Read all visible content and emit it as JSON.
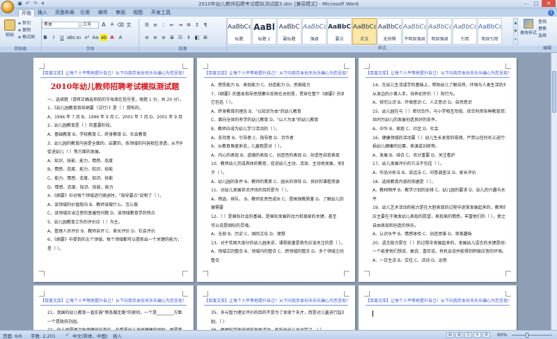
{
  "window": {
    "title": "2010年幼儿教师招聘考试模拟测试题3.doc [兼容模式] - Microsoft Word"
  },
  "tabs": [
    "开始",
    "插入",
    "页面布局",
    "引用",
    "邮件",
    "审阅",
    "视图",
    "开发工具"
  ],
  "clipboard": {
    "paste": "粘贴",
    "cut": "剪切",
    "copy": "复制",
    "format_painter": "格式刷",
    "label": "剪贴板"
  },
  "font": {
    "name": "黑体",
    "size": "三号",
    "grow": "A",
    "shrink": "A",
    "label": "字体"
  },
  "paragraph": {
    "label": "段落"
  },
  "styles": {
    "items": [
      {
        "preview": "AaBbCcDd",
        "name": "标题"
      },
      {
        "preview": "AaBl",
        "name": "标题 1"
      },
      {
        "preview": "AaBbC",
        "name": "副标题"
      },
      {
        "preview": "AaBbCcDd",
        "name": "强调"
      },
      {
        "preview": "AaBbC",
        "name": "要点"
      },
      {
        "preview": "AaBbCcDd",
        "name": "正文"
      },
      {
        "preview": "AaBbCcDd",
        "name": "无间隔"
      },
      {
        "preview": "AaBbCcDd",
        "name": "不明显强调"
      },
      {
        "preview": "AaBbCcDd",
        "name": "明显强调"
      },
      {
        "preview": "AaBbCcDd",
        "name": "引用"
      },
      {
        "preview": "AaBbCcDd",
        "name": "明显引用"
      }
    ],
    "change_styles": "更改样式",
    "label": "样式"
  },
  "editing": {
    "find": "查找",
    "replace": "替换",
    "select": "选择",
    "label": "编辑"
  },
  "pages": {
    "header": "【百度文库】让每个人平等地提升自己！从下向我存本份天乐乐编心为您呈现！",
    "title": "2010年幼儿教师招聘考试模拟测试题",
    "p1": [
      "一、选择题（请将正确选项前的字母填在括号里，每题 1 分，共 20 分）。",
      "1、《幼儿园教育指导纲要（试行）》是（      ）颁布的。",
      "A、1996 年 7 月    B、1996 年 9 月 C、2001 年 7 月    D、2001 年 9 月",
      "2、幼儿园教育是（      ）的重要阶段。",
      "A、基础教育    B、学校教育    C、终身教育    D、社会教育",
      "3、幼儿园的教育内容是全面的、启蒙的，各领域的内容相互渗透，从不同角度",
      "促进幼儿（      ）等方面的发展。",
      "A、知识、技能、能力、情感、态度",
      "B、情感、态度、能力、知识、技能",
      "C、能力、情感、态度、知识、技能",
      "D、情感、态度、知识、技能、能力",
      "4、《纲要》中对每个领域进行阐述时，\"指导要点\"说明了（      ）。",
      "A、该领域的价值取向            B、教师该做什么、怎么做",
      "C、该领域应当注意的普遍性问题       D、该领域教育学的特点",
      "5、幼儿园教育工作的评价应（      ）为主。",
      "A、管理人员评价    B、教师自评    C、家长评价    D、社会评价",
      "6、《纲要》中提到的五个领域，每个领域都可以提炼出一个关键的能力，艺术",
      "是（      ）。"
    ],
    "p2": [
      "A、感受能力    B、表现能力    C、创造能力    D、思维能力",
      "7、《纲要》的基本指导思想集中反映在总则里，贯穿在整个《纲要》的各部分，",
      "它包括（      ）。",
      "A、终身教育的理念       B、\"以知识为本\"的幼儿教育",
      "C、面向全体的有学的幼儿教育  D、\"以人为本\"的幼儿教育",
      "8、教师应成为幼儿学习活动的（      ）。",
      "A、支持者       B、引导者       C、指导者       D、合作者",
      "9、从教育角度来说，儿童观是对（      ）。",
      "A、内心的表现      B、道德的表现 C、创造性的表现     D、创造性自我表现",
      "10、教师幼儿完成具体的教育，促进幼儿主动、活泼、主动地发展，关键在",
      "于（      ）。",
      "A、幼儿园的条件    B、教师的素质 C、园长的领导    D、良好的课程资源",
      "11、对幼儿发展状况评估的目的是为（      ）。",
      "A、筛选、排队、   B、教师反思性成长 C、提高保教质量 D、了解幼儿的发",
      "展需要",
      "12、（      ）是国际社会的基础，是国际发展的动力和源泉的关键，甚至",
      "可以说是国际的灵魂。",
      "A、全部       B、历史       C、国际文化       D、理想",
      "13、对于贫困大部分的幼儿园来说，课程能量是首先应该关注的是（      ）。",
      "A、领域式的整合    B、领域内的整合 C、跨领域的整合 D、多个领域之间的",
      "整合"
    ],
    "p3": [
      "14、在幼儿生活或学的基础上，帮助幼儿了解自然、环境与人类生活的关系。",
      "从身边的小事入手，培养初步的（      ）和行为。",
      "A、探究认识    B、环保意识    C、人文意识    D、自然意识",
      "15、幼儿园在与（      ）密切合作，与小学相互衔接，综合利用各种教育资源，",
      "共同为幼儿的发展创造良好的条件。",
      "A、中华       B、家庭       C、社区       D、社会",
      "16、健康领域的活动要（      ）幼儿生长发育的规律，严禁以任何名义进行有",
      "损幼儿健康的比赛、表演或训练等。",
      "A、发展       B、结合       C、充分重要       D、关注看护",
      "17、幼儿发展评价的方法不包括（      ）。",
      "A、作品分析法    B、谈话法    C、问卷调查法    D、家长评价",
      "18、选择教育内容的依据是（      ）。",
      "A、教材顺序    B、教学计划的安排    C、幼儿园的要求 D、幼儿的兴趣与水",
      "平",
      "19、幼儿艺术活动的能力是在大胆表现的过程中逐渐发展起来的，教师的作用",
      "应主要在于激发幼儿表现的愿望，表现美的情感，丰富他们的（      ），使之体验",
      "自由表现和创造的快乐。",
      "A、认识水平       B、情感体验       C、创造思维       D、审美趣味",
      "20、语言能力是在（      ）的过程中发展起来的，发展幼儿语言的关键是创设",
      "一个能使他们想说、敢说、喜欢说、有机会说并能得到积极应答的环境。",
      "A、一日生活    B、交往       C、活动       D、运用"
    ],
    "p4": [
      "21、我国的幼儿教育一直实施\"两条腿走路\"的原则，一个是________方面，",
      "一个是政府办园。",
      "22、幼儿园要把卫生保健放在首位，在重视幼儿身体健康的同时，更要重视"
    ],
    "p5": [
      "35、多元智力理论评价的目的不是为了发现个天才，而是对儿童进行监测、鼓",
      "励。（      ）",
      "36、根据科学地选择的发展活动，有利于幼儿主动学习。（      ）"
    ]
  },
  "status": {
    "page": "页面: 6/6",
    "words": "字数: 2,201",
    "language": "中文(简体，中国)",
    "insert": "插入",
    "zoom": "60%"
  }
}
